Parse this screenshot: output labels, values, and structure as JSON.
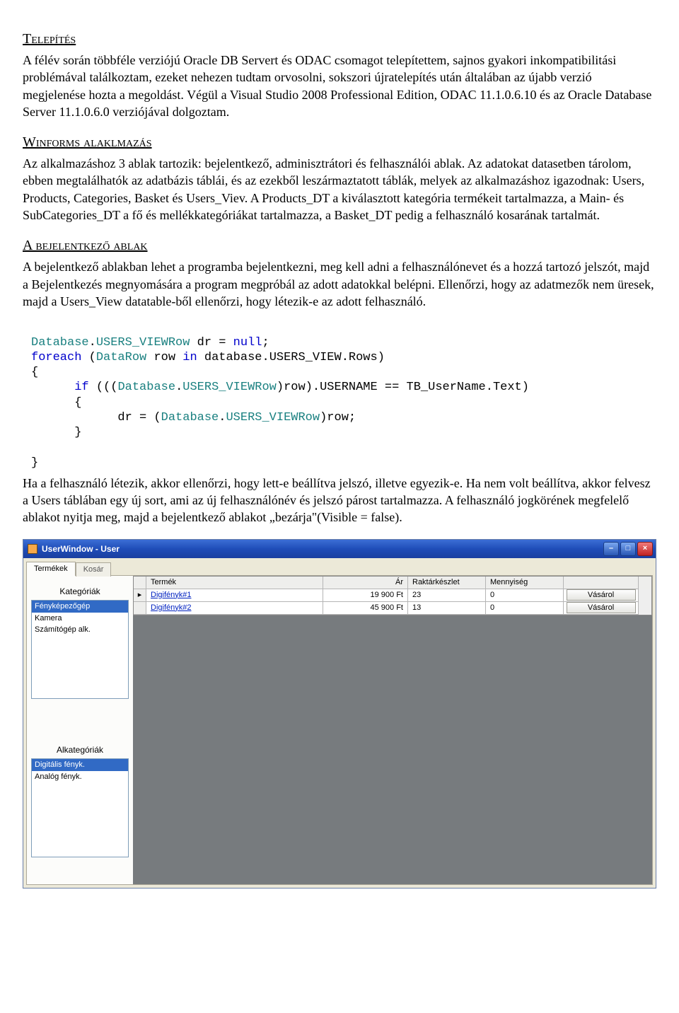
{
  "sections": {
    "install": {
      "title": "Telepítés",
      "body": "A félév során többféle verziójú Oracle DB Servert és ODAC csomagot telepítettem, sajnos gyakori inkompatibilitási problémával találkoztam, ezeket nehezen tudtam orvosolni, sokszori újratelepítés után általában az újabb verzió megjelenése hozta a megoldást. Végül a Visual Studio 2008 Professional Edition, ODAC 11.1.0.6.10 és az Oracle Database Server 11.1.0.6.0 verziójával dolgoztam."
    },
    "winforms": {
      "title": "Winforms alaklmazás",
      "body": "Az alkalmazáshoz 3 ablak tartozik: bejelentkező, adminisztrátori és felhasználói ablak. Az adatokat datasetben tárolom, ebben megtalálhatók az adatbázis táblái, és az ezekből leszármaztatott táblák, melyek az alkalmazáshoz igazodnak: Users, Products, Categories, Basket és Users_Viev. A Products_DT a kiválasztott kategória termékeit tartalmazza, a Main- és SubCategories_DT a fő és mellékkategóriákat tartalmazza, a Basket_DT pedig a felhasználó kosarának tartalmát."
    },
    "login": {
      "title": "A bejelentkező ablak",
      "body1": "A bejelentkező ablakban lehet a programba bejelentkezni, meg kell adni a felhasználónevet és a hozzá tartozó jelszót, majd a Bejelentkezés megnyomására a program megpróbál az adott adatokkal belépni. Ellenőrzi, hogy az adatmezők nem üresek, majd a Users_View datatable-ből ellenőrzi, hogy létezik-e az adott felhasználó.",
      "body2": "Ha a felhasználó létezik, akkor ellenőrzi, hogy lett-e beállítva jelszó, illetve egyezik-e. Ha nem volt beállítva, akkor felvesz a Users táblában egy új sort, ami az új felhasználónév és jelszó párost tartalmazza. A felhasználó jogkörének megfelelő ablakot nyitja meg, majd a bejelentkező ablakot „bezárja\"(Visible = false)."
    }
  },
  "code": {
    "l1a": "Database",
    "l1b": ".",
    "l1c": "USERS_VIEWRow",
    "l1d": " dr = ",
    "l1e": "null",
    "l1f": ";",
    "l2a": "foreach",
    "l2b": " (",
    "l2c": "DataRow",
    "l2d": " row ",
    "l2e": "in",
    "l2f": " database.USERS_VIEW.Rows)",
    "l3": "{",
    "l4a": "      if",
    "l4b": " (((",
    "l4c": "Database",
    "l4d": ".",
    "l4e": "USERS_VIEWRow",
    "l4f": ")row).USERNAME == TB_UserName.Text)",
    "l5": "      {",
    "l6a": "            dr = (",
    "l6b": "Database",
    "l6c": ".",
    "l6d": "USERS_VIEWRow",
    "l6e": ")row;",
    "l7": "      }",
    "l8": "}"
  },
  "app": {
    "title": "UserWindow - User",
    "tabs": {
      "products": "Termékek",
      "basket": "Kosár"
    },
    "left": {
      "categories_label": "Kategóriák",
      "categories": [
        "Fényképezőgép",
        "Kamera",
        "Számítógép alk."
      ],
      "subcategories_label": "Alkategóriák",
      "subcategories": [
        "Digitális fényk.",
        "Analóg fényk."
      ]
    },
    "grid": {
      "headers": {
        "product": "Termék",
        "price": "Ár",
        "stock": "Raktárkészlet",
        "qty": "Mennyiség",
        "buy": ""
      },
      "rows": [
        {
          "product": "Digifényk#1",
          "price": "19 900 Ft",
          "stock": "23",
          "qty": "0",
          "btn": "Vásárol"
        },
        {
          "product": "Digifényk#2",
          "price": "45 900 Ft",
          "stock": "13",
          "qty": "0",
          "btn": "Vásárol"
        }
      ],
      "current_marker": "▸"
    },
    "winbtns": {
      "min": "–",
      "max": "□",
      "close": "×"
    }
  }
}
